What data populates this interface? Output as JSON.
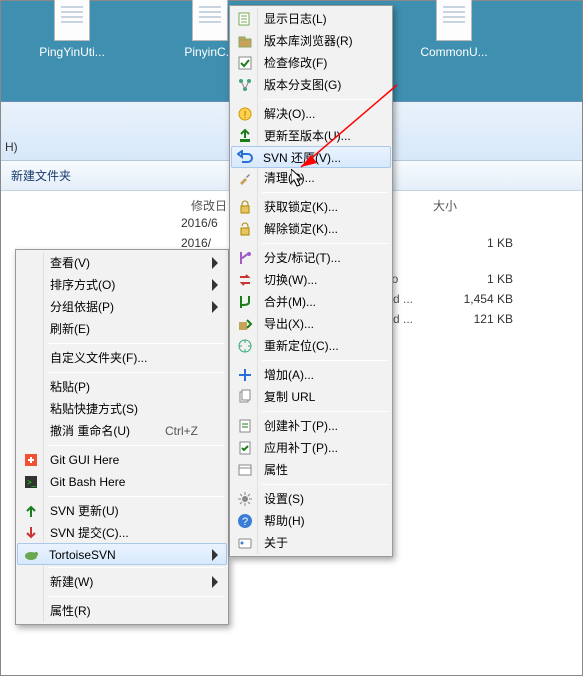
{
  "desktop": {
    "icons": [
      {
        "label": "PingYinUti..."
      },
      {
        "label": "PinyinC..."
      },
      {
        "label": "CommonU..."
      }
    ]
  },
  "explorer": {
    "breadcrumb_tail": "H)",
    "toolbar_new_folder": "新建文件夹",
    "col_date": "修改日",
    "col_size": "大小",
    "rows": [
      {
        "date": "2016/6"
      },
      {
        "date": "2016/",
        "size": "1 KB"
      },
      {
        "type": "lo",
        "size": "1 KB"
      },
      {
        "type": "rd ...",
        "size": "1,454 KB"
      },
      {
        "type": "rd ...",
        "size": "121 KB"
      }
    ]
  },
  "menu1": {
    "items": [
      {
        "name": "view",
        "label": "查看(V)",
        "arrow": true
      },
      {
        "name": "sort",
        "label": "排序方式(O)",
        "arrow": true
      },
      {
        "name": "groupby",
        "label": "分组依据(P)",
        "arrow": true
      },
      {
        "name": "refresh",
        "label": "刷新(E)"
      },
      {
        "sep": true
      },
      {
        "name": "customize",
        "label": "自定义文件夹(F)..."
      },
      {
        "sep": true
      },
      {
        "name": "paste",
        "label": "粘贴(P)"
      },
      {
        "name": "pastelink",
        "label": "粘贴快捷方式(S)"
      },
      {
        "name": "undo",
        "label": "撤消 重命名(U)",
        "shortcut": "Ctrl+Z"
      },
      {
        "sep": true
      },
      {
        "name": "gitgui",
        "label": "Git GUI Here",
        "icon": "git-gui-icon"
      },
      {
        "name": "gitbash",
        "label": "Git Bash Here",
        "icon": "git-bash-icon"
      },
      {
        "sep": true
      },
      {
        "name": "svnupdate",
        "label": "SVN 更新(U)",
        "icon": "svn-update-icon"
      },
      {
        "name": "svncommit",
        "label": "SVN 提交(C)...",
        "icon": "svn-commit-icon"
      },
      {
        "name": "tortoise",
        "label": "TortoiseSVN",
        "icon": "tortoise-icon",
        "arrow": true,
        "hover": true
      },
      {
        "sep": true
      },
      {
        "name": "new",
        "label": "新建(W)",
        "arrow": true
      },
      {
        "sep": true
      },
      {
        "name": "props",
        "label": "属性(R)"
      }
    ]
  },
  "menu2": {
    "items": [
      {
        "name": "showlog",
        "label": "显示日志(L)",
        "icon": "log-icon"
      },
      {
        "name": "repo",
        "label": "版本库浏览器(R)",
        "icon": "repo-icon"
      },
      {
        "name": "checkmod",
        "label": "检查修改(F)",
        "icon": "check-icon"
      },
      {
        "name": "revgraph",
        "label": "版本分支图(G)",
        "icon": "graph-icon"
      },
      {
        "sep": true
      },
      {
        "name": "resolve",
        "label": "解决(O)...",
        "icon": "resolve-icon"
      },
      {
        "name": "uptorev",
        "label": "更新至版本(U)...",
        "icon": "update-to-icon"
      },
      {
        "name": "revert",
        "label": "SVN 还原(V)...",
        "icon": "revert-icon",
        "hover": true
      },
      {
        "name": "cleanup",
        "label": "清理(C)...",
        "icon": "cleanup-icon"
      },
      {
        "sep": true
      },
      {
        "name": "getlock",
        "label": "获取锁定(K)...",
        "icon": "lock-icon"
      },
      {
        "name": "rellock",
        "label": "解除锁定(K)...",
        "icon": "unlock-icon"
      },
      {
        "sep": true
      },
      {
        "name": "branch",
        "label": "分支/标记(T)...",
        "icon": "branch-icon"
      },
      {
        "name": "switch",
        "label": "切换(W)...",
        "icon": "switch-icon"
      },
      {
        "name": "merge",
        "label": "合并(M)...",
        "icon": "merge-icon"
      },
      {
        "name": "export",
        "label": "导出(X)...",
        "icon": "export-icon"
      },
      {
        "name": "relocate",
        "label": "重新定位(C)...",
        "icon": "relocate-icon"
      },
      {
        "sep": true
      },
      {
        "name": "add",
        "label": "增加(A)...",
        "icon": "add-icon"
      },
      {
        "name": "copyurl",
        "label": "复制 URL",
        "icon": "copy-icon"
      },
      {
        "sep": true
      },
      {
        "name": "createpatch",
        "label": "创建补丁(P)...",
        "icon": "create-patch-icon"
      },
      {
        "name": "applypatch",
        "label": "应用补丁(P)...",
        "icon": "apply-patch-icon"
      },
      {
        "name": "svnprops",
        "label": "属性",
        "icon": "props-icon"
      },
      {
        "sep": true
      },
      {
        "name": "settings",
        "label": "设置(S)",
        "icon": "settings-icon"
      },
      {
        "name": "help",
        "label": "帮助(H)",
        "icon": "help-icon"
      },
      {
        "name": "about",
        "label": "关于",
        "icon": "about-icon"
      }
    ]
  }
}
